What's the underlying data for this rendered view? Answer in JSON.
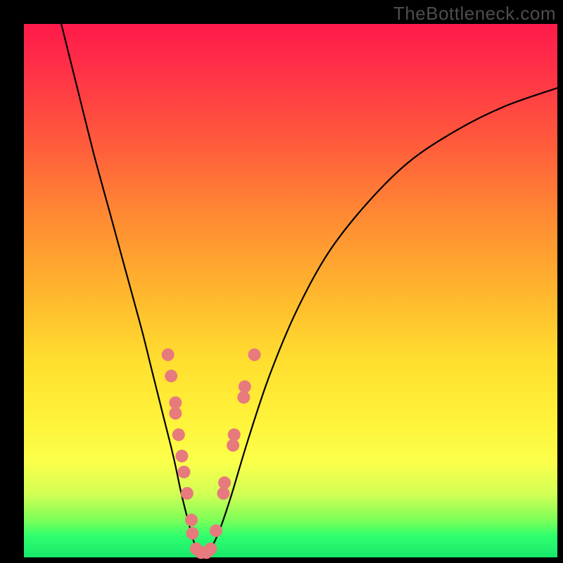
{
  "watermark": "TheBottleneck.com",
  "chart_data": {
    "type": "line",
    "title": "",
    "xlabel": "",
    "ylabel": "",
    "xlim": [
      0,
      100
    ],
    "ylim": [
      0,
      100
    ],
    "series": [
      {
        "name": "bottleneck-curve",
        "x": [
          7,
          10,
          13,
          16,
          19,
          22,
          24,
          26,
          28,
          29.5,
          31,
          32,
          33,
          34,
          35.5,
          37,
          39,
          42,
          46,
          51,
          57,
          64,
          72,
          81,
          90,
          100
        ],
        "y": [
          100,
          88,
          76,
          65,
          54,
          43,
          35,
          27,
          19,
          12,
          6,
          2.5,
          0.8,
          0.8,
          2.5,
          6,
          12,
          22,
          34,
          46,
          57,
          66,
          74,
          80,
          84.5,
          88
        ]
      }
    ],
    "markers": {
      "name": "highlighted-points",
      "color": "#e77a7d",
      "points": [
        {
          "x": 27.0,
          "y": 38
        },
        {
          "x": 27.6,
          "y": 34
        },
        {
          "x": 28.4,
          "y": 29
        },
        {
          "x": 28.4,
          "y": 27
        },
        {
          "x": 29.0,
          "y": 23
        },
        {
          "x": 29.6,
          "y": 19
        },
        {
          "x": 30.0,
          "y": 16
        },
        {
          "x": 30.6,
          "y": 12
        },
        {
          "x": 31.4,
          "y": 7
        },
        {
          "x": 31.6,
          "y": 4.5
        },
        {
          "x": 32.3,
          "y": 1.6
        },
        {
          "x": 33.2,
          "y": 0.9
        },
        {
          "x": 34.2,
          "y": 0.9
        },
        {
          "x": 35.0,
          "y": 1.6
        },
        {
          "x": 36.0,
          "y": 5
        },
        {
          "x": 37.4,
          "y": 12
        },
        {
          "x": 37.6,
          "y": 14
        },
        {
          "x": 39.2,
          "y": 21
        },
        {
          "x": 39.4,
          "y": 23
        },
        {
          "x": 41.2,
          "y": 30
        },
        {
          "x": 41.4,
          "y": 32
        },
        {
          "x": 43.2,
          "y": 38
        }
      ]
    },
    "gradient_stops": [
      {
        "pos": 0.0,
        "color": "#ff1a4b"
      },
      {
        "pos": 0.5,
        "color": "#ffb52e"
      },
      {
        "pos": 0.82,
        "color": "#fbff4a"
      },
      {
        "pos": 1.0,
        "color": "#18e86a"
      }
    ]
  }
}
